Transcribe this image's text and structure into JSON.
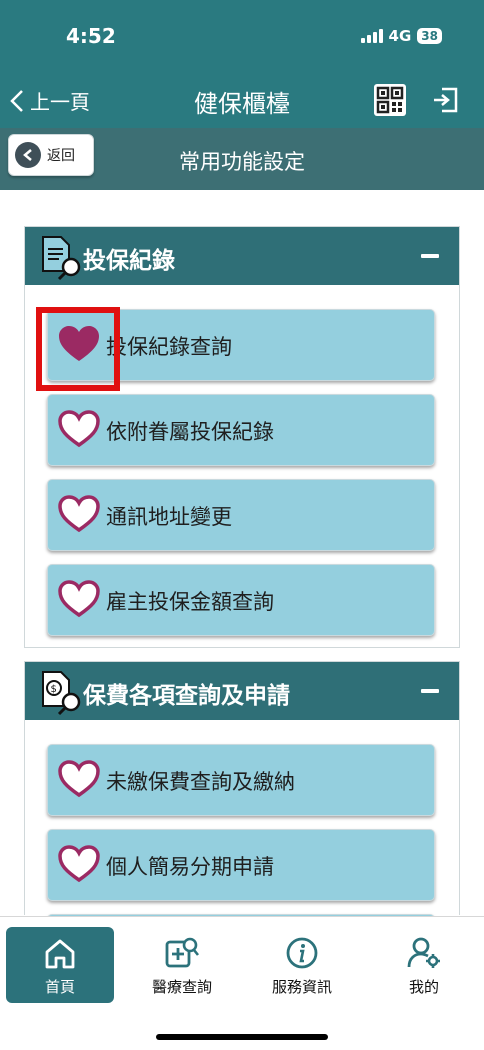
{
  "status_bar": {
    "time": "4:52",
    "network": "4G",
    "battery": "38"
  },
  "nav": {
    "back_label": "上一頁",
    "title": "健保櫃檯"
  },
  "subheader": {
    "back_label": "返回",
    "title": "常用功能設定"
  },
  "sections": [
    {
      "title": "投保紀錄",
      "icon": "document-search-icon",
      "items": [
        {
          "label": "投保紀錄查詢",
          "favorite": true
        },
        {
          "label": "依附眷屬投保紀錄",
          "favorite": false
        },
        {
          "label": "通訊地址變更",
          "favorite": false
        },
        {
          "label": "雇主投保金額查詢",
          "favorite": false
        }
      ]
    },
    {
      "title": "保費各項查詢及申請",
      "icon": "bill-search-icon",
      "items": [
        {
          "label": "未繳保費查詢及繳納",
          "favorite": false
        },
        {
          "label": "個人簡易分期申請",
          "favorite": false
        }
      ]
    }
  ],
  "tabs": [
    {
      "label": "首頁",
      "icon": "home-icon",
      "active": true
    },
    {
      "label": "醫療查詢",
      "icon": "medical-search-icon",
      "active": false
    },
    {
      "label": "服務資訊",
      "icon": "info-icon",
      "active": false
    },
    {
      "label": "我的",
      "icon": "user-settings-icon",
      "active": false
    }
  ],
  "colors": {
    "primary": "#2a7a80",
    "item_bg": "#94cfde",
    "heart": "#9b2a63",
    "highlight": "#e01010"
  }
}
